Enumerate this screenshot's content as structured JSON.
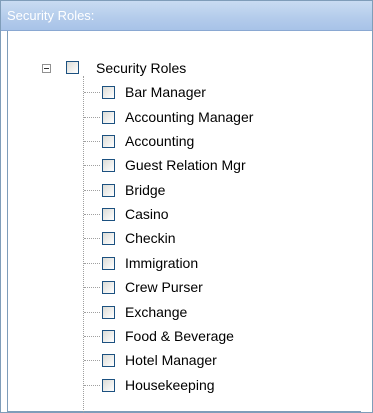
{
  "panel": {
    "title": "Security Roles:"
  },
  "tree": {
    "root": {
      "label": "Security Roles",
      "expanded": true,
      "checked": false
    },
    "items": [
      {
        "label": "Bar Manager",
        "checked": false
      },
      {
        "label": "Accounting Manager",
        "checked": false
      },
      {
        "label": "Accounting",
        "checked": false
      },
      {
        "label": "Guest Relation Mgr",
        "checked": false
      },
      {
        "label": "Bridge",
        "checked": false
      },
      {
        "label": "Casino",
        "checked": false
      },
      {
        "label": "Checkin",
        "checked": false
      },
      {
        "label": "Immigration",
        "checked": false
      },
      {
        "label": "Crew Purser",
        "checked": false
      },
      {
        "label": "Exchange",
        "checked": false
      },
      {
        "label": "Food & Beverage",
        "checked": false
      },
      {
        "label": "Hotel Manager",
        "checked": false
      },
      {
        "label": "Housekeeping",
        "checked": false
      }
    ]
  },
  "colors": {
    "header_gradient_top": "#c9dcf2",
    "header_gradient_bottom": "#a8c3e8",
    "border": "#7f9db9",
    "checkbox_border": "#1c5180"
  }
}
